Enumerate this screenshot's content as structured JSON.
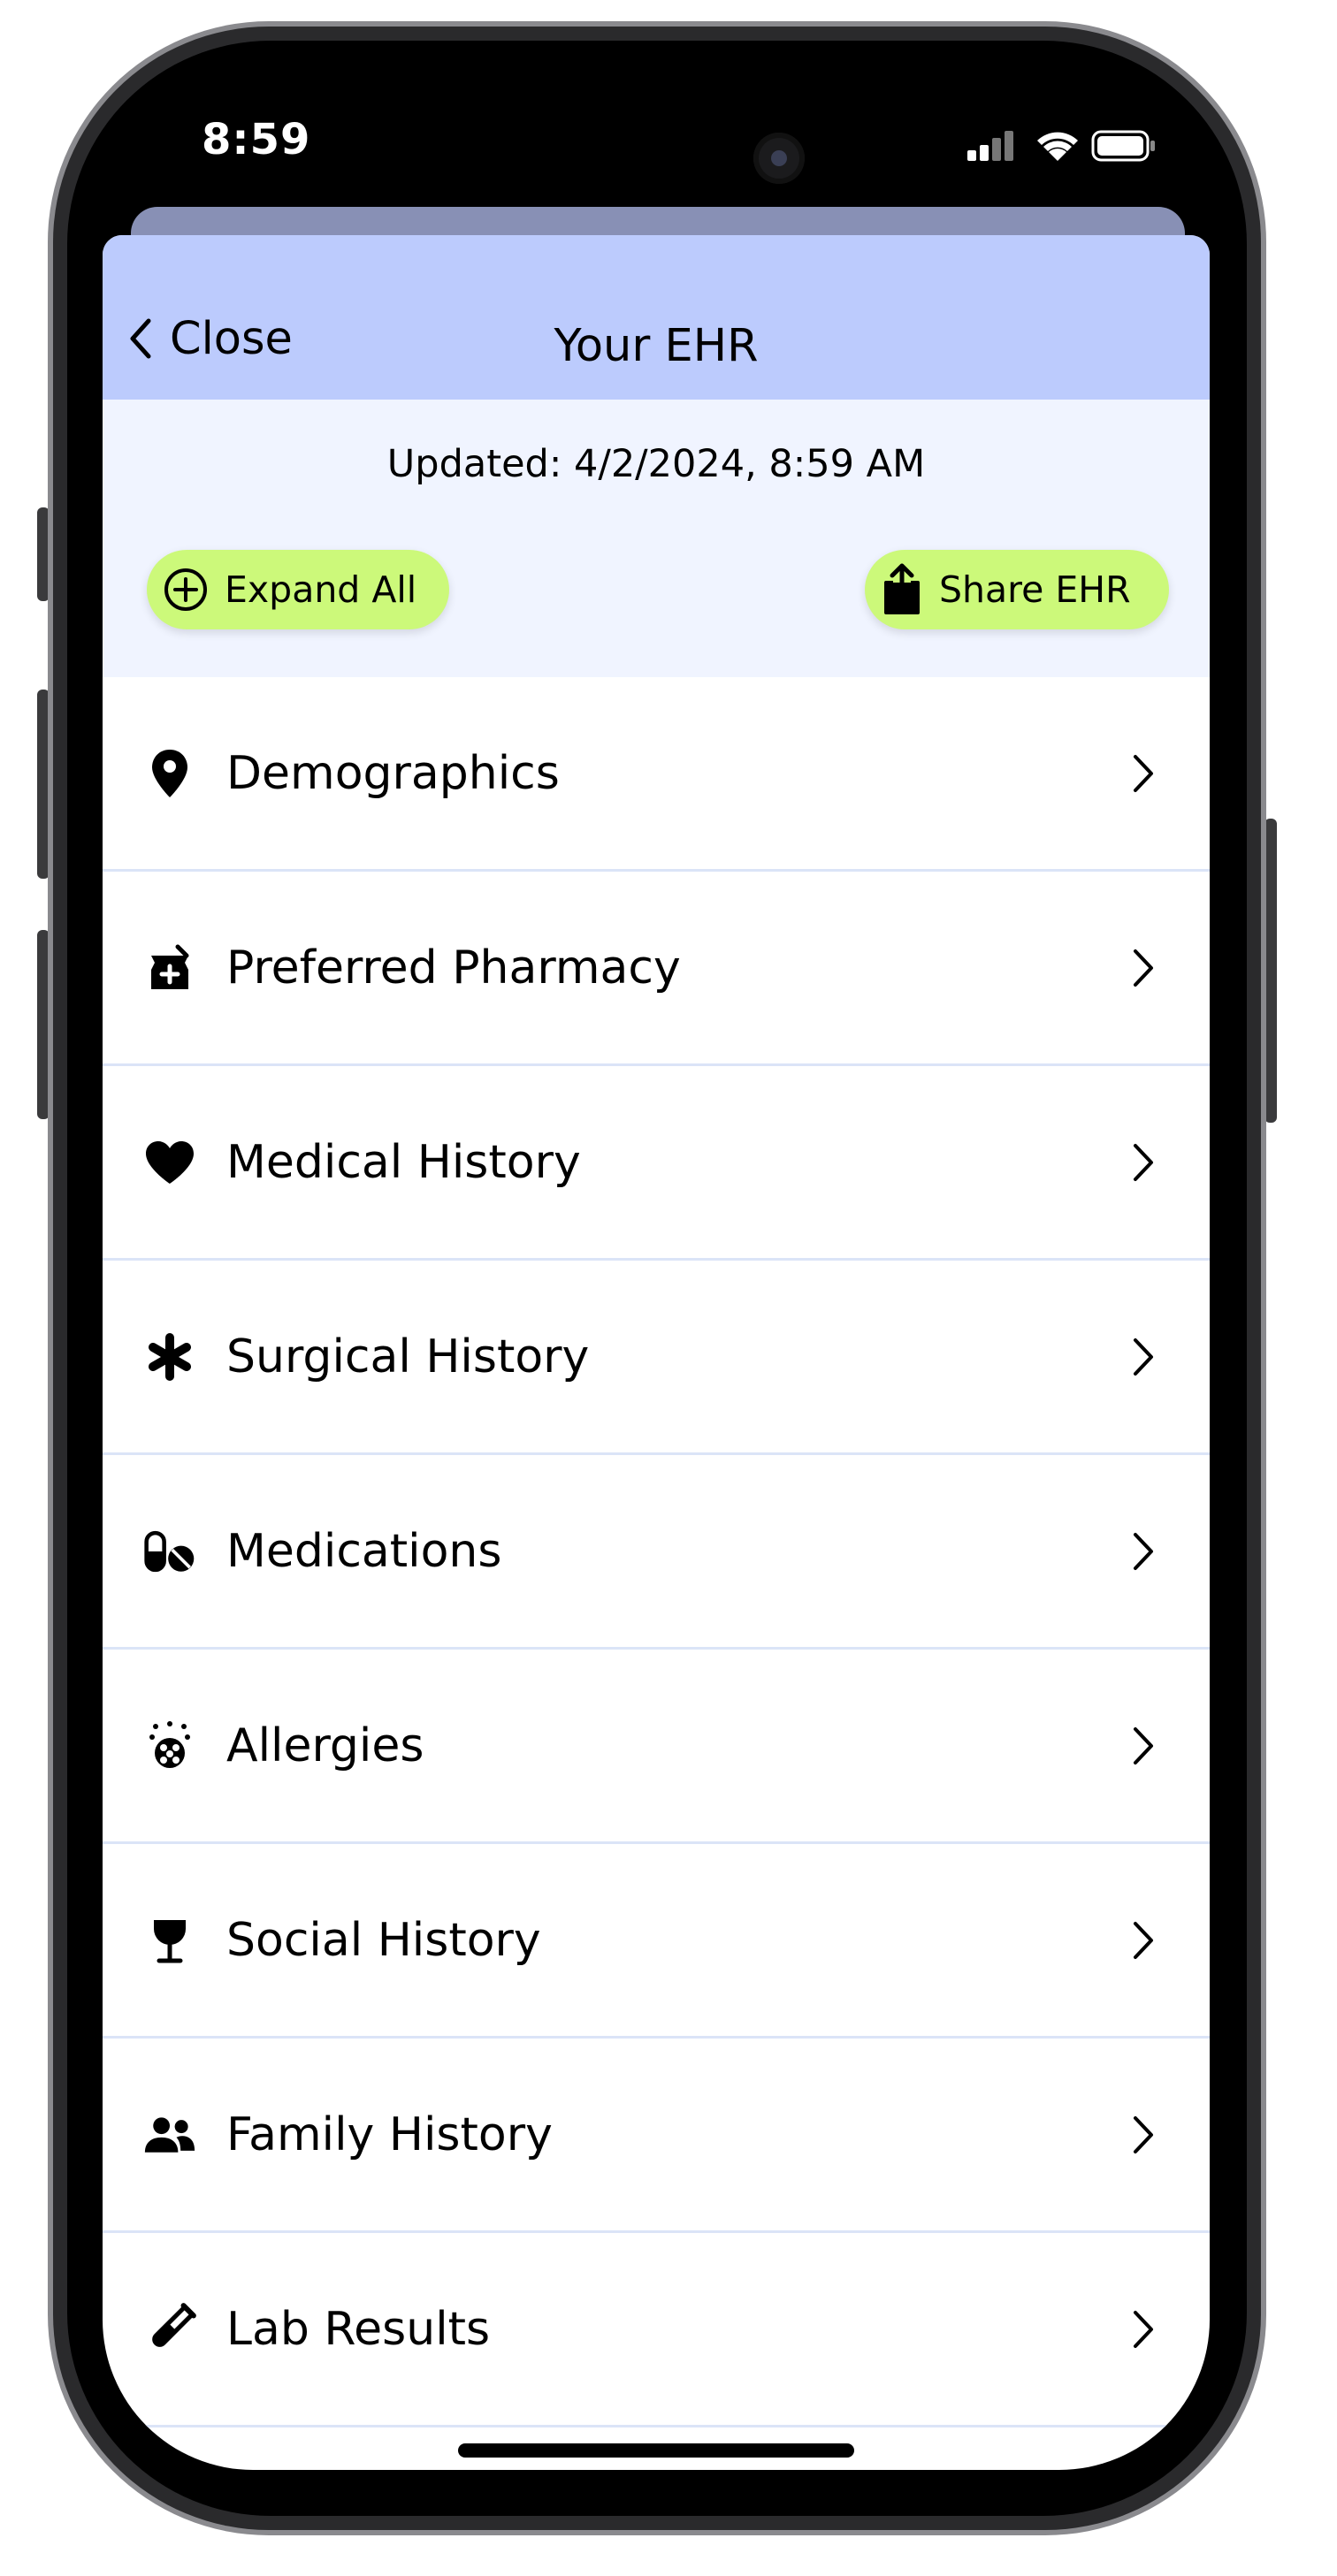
{
  "status_bar": {
    "time": "8:59"
  },
  "header": {
    "close_label": "Close",
    "title": "Your EHR"
  },
  "updated_text": "Updated: 4/2/2024, 8:59 AM",
  "actions": {
    "expand_label": "Expand All",
    "share_label": "Share EHR"
  },
  "sections": [
    {
      "label": "Demographics",
      "icon": "location-pin-icon"
    },
    {
      "label": "Preferred Pharmacy",
      "icon": "pharmacy-icon"
    },
    {
      "label": "Medical History",
      "icon": "heart-icon"
    },
    {
      "label": "Surgical History",
      "icon": "asterisk-icon"
    },
    {
      "label": "Medications",
      "icon": "pills-icon"
    },
    {
      "label": "Allergies",
      "icon": "allergen-icon"
    },
    {
      "label": "Social History",
      "icon": "wine-glass-icon"
    },
    {
      "label": "Family History",
      "icon": "people-icon"
    },
    {
      "label": "Lab Results",
      "icon": "test-tube-icon"
    }
  ],
  "colors": {
    "nav_bar": "#bccbfd",
    "info_background": "#f0f4ff",
    "pill_button": "#ccf97a",
    "divider": "#dbe4f7"
  }
}
